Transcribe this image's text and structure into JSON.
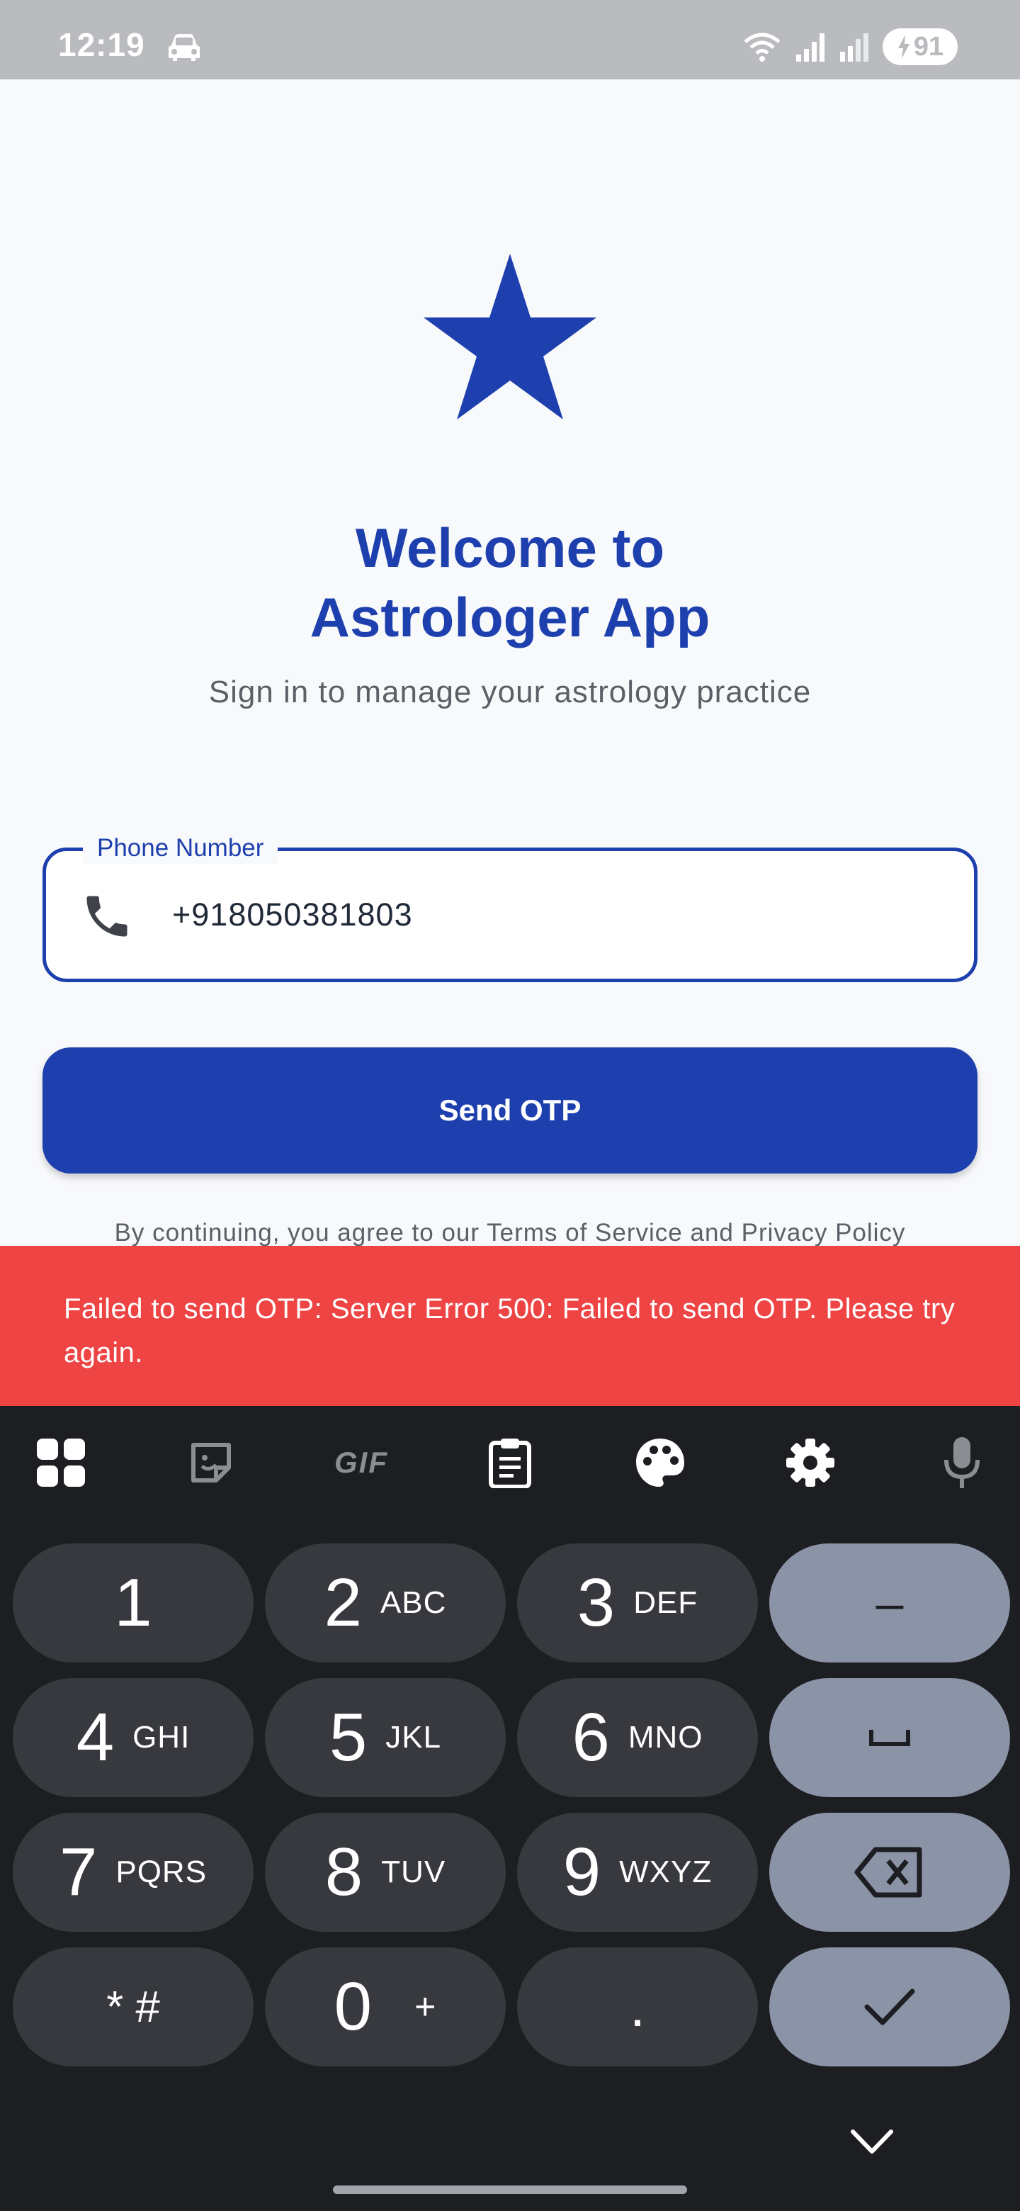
{
  "status_bar": {
    "time": "12:19",
    "battery": "91",
    "icons": [
      "car-icon",
      "wifi-icon",
      "signal-icon",
      "roaming-signal-icon",
      "battery-charging-icon"
    ]
  },
  "app": {
    "logo_icon": "star-icon",
    "title_line1": "Welcome to",
    "title_line2": "Astrologer App",
    "subtitle": "Sign in to manage your astrology practice",
    "phone_field": {
      "label": "Phone Number",
      "value": "+918050381803",
      "icon": "phone-icon"
    },
    "send_button": "Send OTP",
    "terms": "By continuing, you agree to our Terms of Service and Privacy Policy",
    "snackbar": "Failed to send OTP: Server Error 500: Failed to send OTP. Please try again."
  },
  "keyboard": {
    "toolbar": {
      "gif_label": "GIF",
      "icons": [
        "apps-grid-icon",
        "sticker-icon",
        "gif-icon",
        "clipboard-icon",
        "palette-icon",
        "settings-icon",
        "microphone-icon"
      ]
    },
    "rows": [
      [
        {
          "digit": "1",
          "letters": ""
        },
        {
          "digit": "2",
          "letters": "ABC"
        },
        {
          "digit": "3",
          "letters": "DEF"
        },
        {
          "func": "–"
        }
      ],
      [
        {
          "digit": "4",
          "letters": "GHI"
        },
        {
          "digit": "5",
          "letters": "JKL"
        },
        {
          "digit": "6",
          "letters": "MNO"
        },
        {
          "func": "space"
        }
      ],
      [
        {
          "digit": "7",
          "letters": "PQRS"
        },
        {
          "digit": "8",
          "letters": "TUV"
        },
        {
          "digit": "9",
          "letters": "WXYZ"
        },
        {
          "func": "backspace"
        }
      ],
      [
        {
          "digit": "* #",
          "letters": ""
        },
        {
          "digit": "0",
          "letters": "+"
        },
        {
          "digit": ".",
          "letters": ""
        },
        {
          "func": "done"
        }
      ]
    ]
  },
  "colors": {
    "primary": "#1e40af",
    "error": "#ef4444",
    "keyboard_bg": "#1c1e22",
    "key_bg": "#37393e",
    "func_key_bg": "#8b93a7"
  }
}
